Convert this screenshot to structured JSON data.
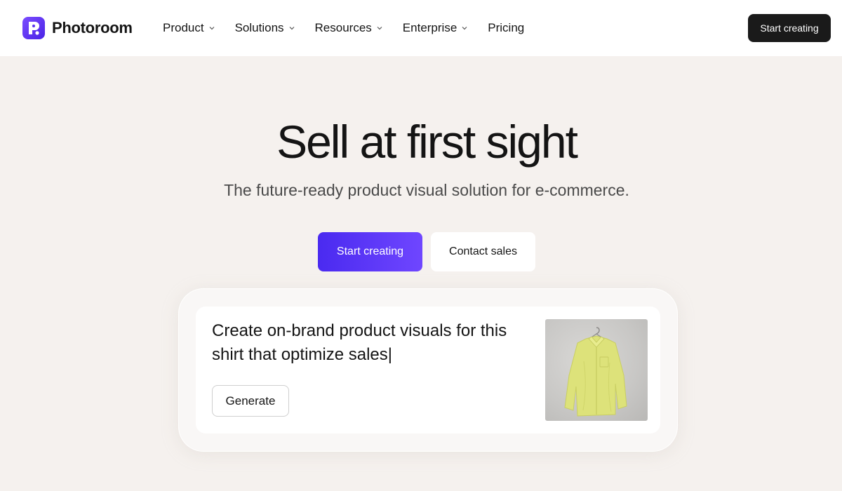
{
  "brand": {
    "name": "Photoroom",
    "accent": "#5433f5"
  },
  "nav": {
    "items": [
      {
        "label": "Product",
        "has_dropdown": true
      },
      {
        "label": "Solutions",
        "has_dropdown": true
      },
      {
        "label": "Resources",
        "has_dropdown": true
      },
      {
        "label": "Enterprise",
        "has_dropdown": true
      },
      {
        "label": "Pricing",
        "has_dropdown": false
      }
    ],
    "cta_label": "Start creating"
  },
  "hero": {
    "title": "Sell at first sight",
    "subtitle": "The future-ready product visual solution for e-commerce.",
    "primary_label": "Start creating",
    "secondary_label": "Contact sales"
  },
  "demo": {
    "prompt": "Create on-brand product visuals for this shirt that optimize sales|",
    "generate_label": "Generate",
    "image_subject": "yellow-shirt-on-hanger"
  }
}
